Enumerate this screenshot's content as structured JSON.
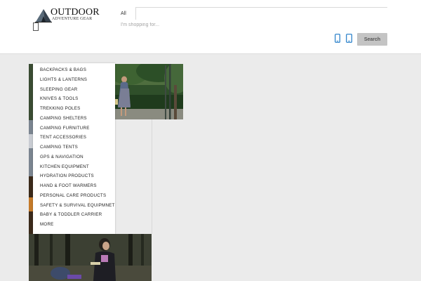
{
  "brand": {
    "name": "OUTDOOR",
    "tagline": "ADVENTURE GEAR"
  },
  "search": {
    "category_label": "All",
    "placeholder": "I'm shopping for...",
    "button_label": "Search"
  },
  "menu": {
    "items": [
      "BACKPACKS & BAGS",
      "LIGHTS & LANTERNS",
      "SLEEPING GEAR",
      "KNIVES & TOOLS",
      "TREKKING POLES",
      "CAMPING SHELTERS",
      "CAMPING FURNITURE",
      "TENT ACCESSORIES",
      "CAMPING TENTS",
      "GPS & NAVIGATION",
      "KITCHEN EQUIPMENT",
      "HYDRATION PRODUCTS",
      "HAND & FOOT WARMERS",
      "PERSONAL CARE PRODUCTS",
      "SAFETY & SURVIVAL EQUIPMNET",
      "BABY & TODDLER CARRIER",
      "MORE"
    ]
  },
  "colors": {
    "header_bg": "#ffffff",
    "page_bg": "#ebebeb",
    "device_icon": "#1f7ac7",
    "search_button": "#c4c4c4"
  },
  "icons": [
    "tent-logo-icon",
    "menu-icon",
    "mobile-icon",
    "tablet-icon"
  ]
}
